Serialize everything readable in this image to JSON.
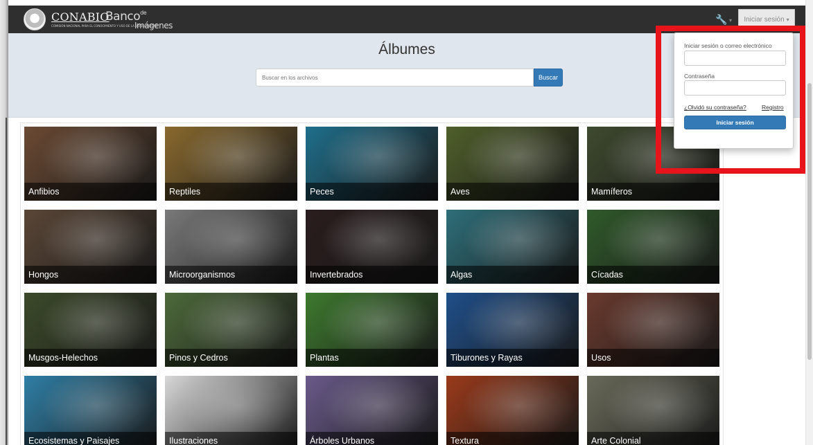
{
  "navbar": {
    "org_name": "CONABIO",
    "org_subtitle": "COMISIÓN NACIONAL PARA EL CONOCIMIENTO Y USO DE LA BIODIVERSIDAD",
    "banco_word": "Banco",
    "banco_de": "de",
    "banco_imagenes": "Imágenes",
    "login_toggle_label": "Iniciar sesión"
  },
  "header": {
    "title": "Álbumes",
    "search_placeholder": "Buscar en los archivos",
    "search_button": "Buscar"
  },
  "albums": [
    {
      "label": "Anfibios",
      "color": "#6b4a33"
    },
    {
      "label": "Reptiles",
      "color": "#8a6a2e"
    },
    {
      "label": "Peces",
      "color": "#1f6f8b"
    },
    {
      "label": "Aves",
      "color": "#4f5f2a"
    },
    {
      "label": "Mamíferos",
      "color": "#3e4a2e"
    },
    {
      "label": "Hongos",
      "color": "#5a4636"
    },
    {
      "label": "Microorganismos",
      "color": "#7a7a7a"
    },
    {
      "label": "Invertebrados",
      "color": "#2a1d1d"
    },
    {
      "label": "Algas",
      "color": "#2e6f7a"
    },
    {
      "label": "Cícadas",
      "color": "#2f5a2a"
    },
    {
      "label": "Musgos-Helechos",
      "color": "#3c4a2a"
    },
    {
      "label": "Pinos y Cedros",
      "color": "#4d6a3a"
    },
    {
      "label": "Plantas",
      "color": "#3d7a2e"
    },
    {
      "label": "Tiburones y Rayas",
      "color": "#1f4f8a"
    },
    {
      "label": "Usos",
      "color": "#6a3a2e"
    },
    {
      "label": "Ecosistemas y Paisajes",
      "color": "#2f7fa6"
    },
    {
      "label": "Ilustraciones",
      "color": "#d8d8d8"
    },
    {
      "label": "Árboles Urbanos",
      "color": "#6a5a8a"
    },
    {
      "label": "Textura",
      "color": "#9a3a1a"
    },
    {
      "label": "Arte Colonial",
      "color": "#6a6a5a"
    }
  ],
  "login_dropdown": {
    "user_label": "Iniciar sesión o correo electrónico",
    "password_label": "Contraseña",
    "forgot_link": "¿Olvidó su contraseña?",
    "register_link": "Registro",
    "submit_label": "Iniciar sesión"
  }
}
